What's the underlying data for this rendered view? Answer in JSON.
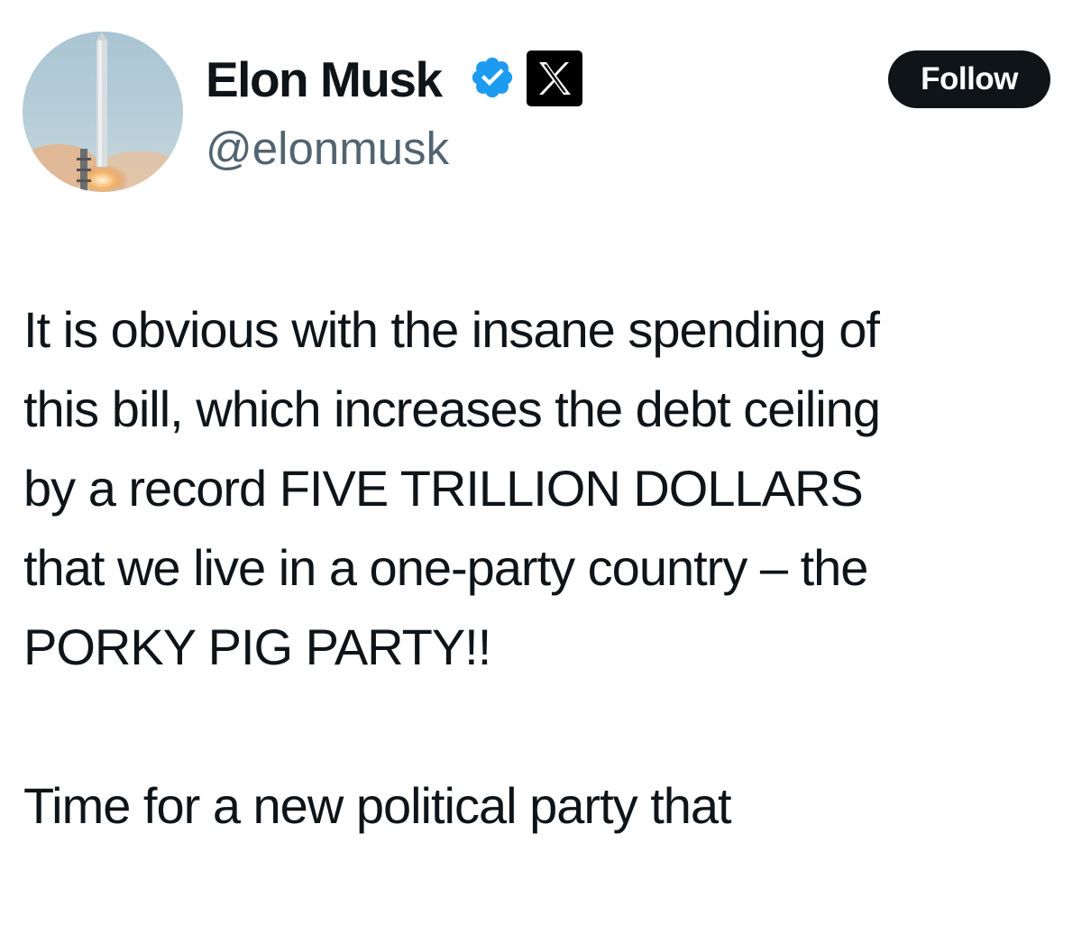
{
  "author": {
    "display_name": "Elon Musk",
    "handle": "@elonmusk",
    "verified_badge_icon": "verified-badge-icon",
    "affiliate_badge_icon": "x-logo-icon",
    "avatar": "rocket-launch-avatar"
  },
  "actions": {
    "follow_label": "Follow"
  },
  "tweet": {
    "paragraphs": [
      "It is obvious with the insane spending of\nthis bill, which increases the debt ceiling\nby a record FIVE TRILLION DOLLARS\nthat we live in a one-party country – the\nPORKY PIG PARTY!!",
      "Time for a new political party that"
    ]
  },
  "colors": {
    "text_primary": "#0f1419",
    "text_secondary": "#536471",
    "verified_blue": "#1d9bf0",
    "follow_button_bg": "#0f1419"
  }
}
